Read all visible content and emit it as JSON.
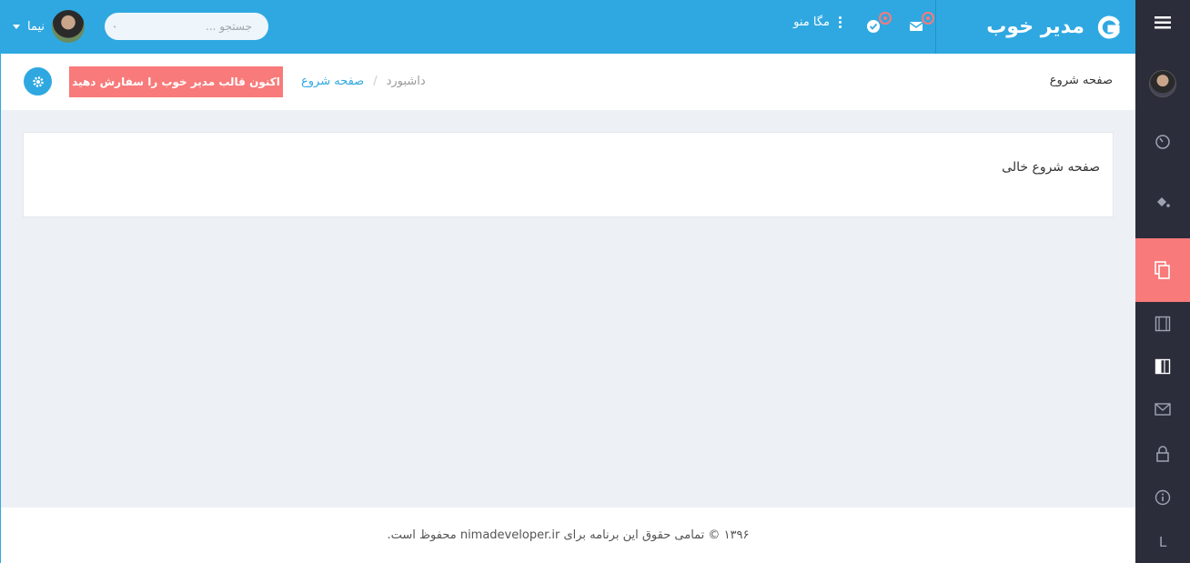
{
  "brand": {
    "name": "مدیر خوب"
  },
  "topbar": {
    "mega_menu_label": "مگا منو",
    "search_placeholder": "جستجو ...",
    "user_name": "نیما"
  },
  "header": {
    "page_title": "صفحه شروع",
    "breadcrumb": {
      "home": "داشبورد",
      "separator": "/",
      "current": "صفحه شروع"
    },
    "order_button_label": "اکنون قالب مدیر خوب را سفارش دهید"
  },
  "main": {
    "empty_text": "صفحه شروع خالی"
  },
  "footer": {
    "text": "۱۳۹۶ © تمامی حقوق این برنامه برای nimadeveloper.ir محفوظ است."
  },
  "sidebar": {
    "items": [
      {
        "icon": "menu-icon"
      },
      {
        "icon": "avatar"
      },
      {
        "icon": "dashboard-icon"
      },
      {
        "icon": "paint-bucket-icon"
      },
      {
        "icon": "copy-pages-icon",
        "active": true
      },
      {
        "icon": "film-icon"
      },
      {
        "icon": "layout-icon"
      },
      {
        "icon": "mail-icon"
      },
      {
        "icon": "lock-icon"
      },
      {
        "icon": "info-icon"
      },
      {
        "icon": "letter-l-icon",
        "label": "L"
      }
    ]
  },
  "colors": {
    "primary": "#2fa8e1",
    "accent": "#f87a7a",
    "sidebar": "#2b2d3a",
    "background": "#edf0f5"
  }
}
